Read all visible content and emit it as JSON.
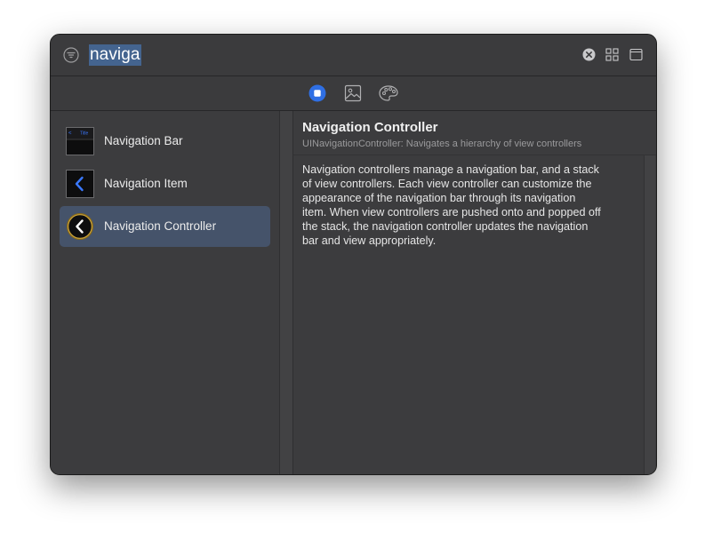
{
  "search": {
    "query": "naviga"
  },
  "icons": {
    "filter": "filter-icon",
    "clear": "clear-circle-icon",
    "grid": "grid-view-icon",
    "panel": "panel-toggle-icon",
    "objects_tab": "square-stop-icon",
    "media_tab": "image-icon",
    "colors_tab": "palette-icon"
  },
  "colors": {
    "selection_highlight": "#44648f",
    "selected_row": "#45536a",
    "accent_blue": "#2f6fe4",
    "thumb_gold": "#c8a23c"
  },
  "library": {
    "items": [
      {
        "label": "Navigation Bar",
        "thumb": "navigation-bar-thumb-icon",
        "thumb_text": "Title",
        "selected": false
      },
      {
        "label": "Navigation Item",
        "thumb": "navigation-item-thumb-icon",
        "selected": false
      },
      {
        "label": "Navigation Controller",
        "thumb": "navigation-controller-thumb-icon",
        "selected": true
      }
    ]
  },
  "detail": {
    "title": "Navigation Controller",
    "subtitle": "UINavigationController: Navigates a hierarchy of view controllers",
    "body_lines": [
      "Navigation controllers manage a navigation bar, and a stack",
      "of view controllers. Each view controller can customize the",
      "appearance of the navigation bar through its navigation",
      "item. When view controllers are pushed onto and popped off",
      "the stack, the navigation controller updates the navigation",
      "bar and view appropriately."
    ]
  }
}
